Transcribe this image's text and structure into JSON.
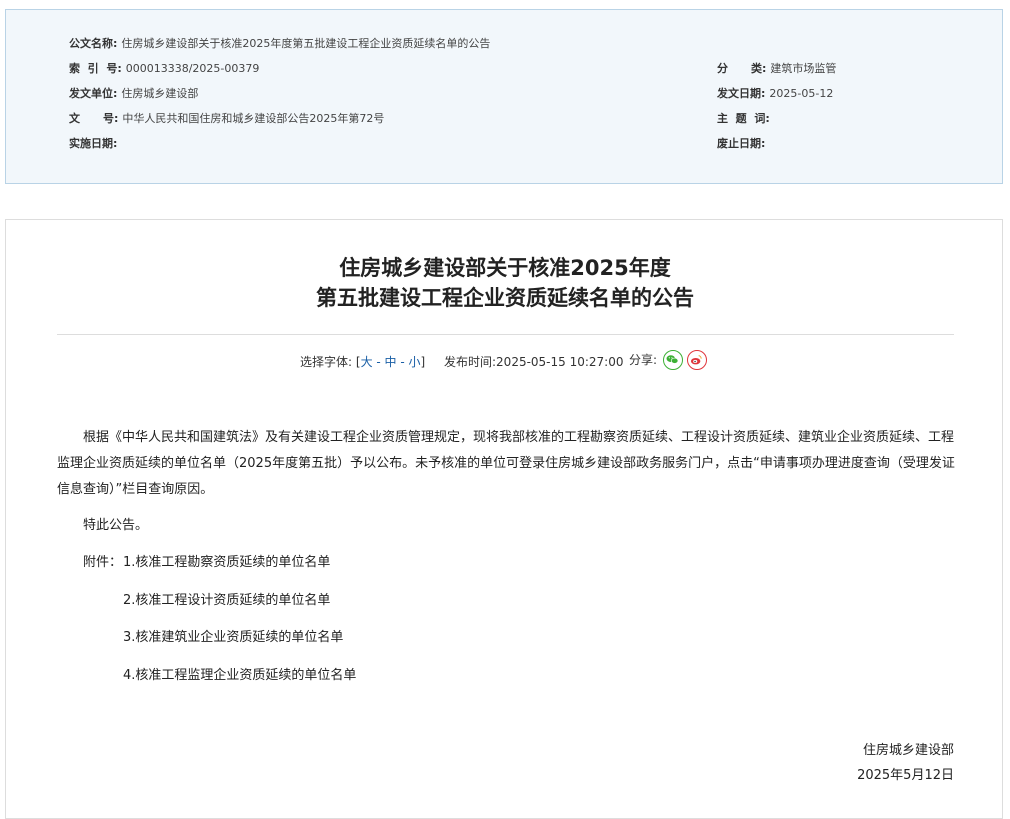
{
  "meta": {
    "title_label": "公文名称:",
    "title_value": "住房城乡建设部关于核准2025年度第五批建设工程企业资质延续名单的公告",
    "index_label": "索  引  号:",
    "index_value": "000013338/2025-00379",
    "category_label": "分      类:",
    "category_value": "建筑市场监管",
    "issuer_label": "发文单位:",
    "issuer_value": "住房城乡建设部",
    "issue_date_label": "发文日期:",
    "issue_date_value": "2025-05-12",
    "doc_no_label": "文      号:",
    "doc_no_value": "中华人民共和国住房和城乡建设部公告2025年第72号",
    "keywords_label": "主  题  词:",
    "keywords_value": "",
    "effective_label": "实施日期:",
    "effective_value": "",
    "expiry_label": "废止日期:",
    "expiry_value": ""
  },
  "article": {
    "title_line1": "住房城乡建设部关于核准2025年度",
    "title_line2": "第五批建设工程企业资质延续名单的公告",
    "font_select_label": "选择字体:",
    "font_bracket_open": "[",
    "font_large": "大",
    "font_sep1": " - ",
    "font_medium": "中",
    "font_sep2": " - ",
    "font_small": "小",
    "font_bracket_close": "]",
    "publish_label": "发布时间:",
    "publish_time": "2025-05-15 10:27:00",
    "share_label": "分享:",
    "paragraph1": "根据《中华人民共和国建筑法》及有关建设工程企业资质管理规定，现将我部核准的工程勘察资质延续、工程设计资质延续、建筑业企业资质延续、工程监理企业资质延续的单位名单（2025年度第五批）予以公布。未予核准的单位可登录住房城乡建设部政务服务门户，点击“申请事项办理进度查询（受理发证信息查询）”栏目查询原因。",
    "paragraph2": "特此公告。",
    "attachment_label": "附件：",
    "attachments": [
      "1.核准工程勘察资质延续的单位名单",
      "2.核准工程设计资质延续的单位名单",
      "3.核准建筑业企业资质延续的单位名单",
      "4.核准工程监理企业资质延续的单位名单"
    ],
    "signature_org": "住房城乡建设部",
    "signature_date": "2025年5月12日"
  },
  "colors": {
    "meta_bg": "#f2f7fb",
    "meta_border": "#b9d3e6",
    "link": "#1a5fa6",
    "wechat": "#3cb034",
    "weibo": "#e0353b"
  }
}
